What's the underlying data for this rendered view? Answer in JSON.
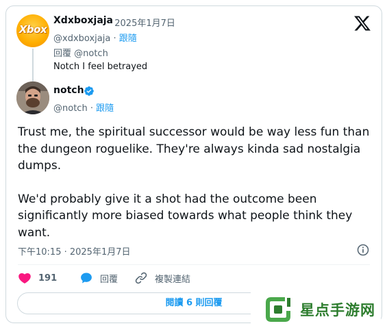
{
  "reply": {
    "display_name": "Xdxboxjaja",
    "date": "· 2025年1月7日",
    "handle": "@xdxboxjaja",
    "follow_label": "跟隨",
    "replying_to": "回覆 @notch",
    "text": "Notch I feel betrayed",
    "avatar_text": "Xbox"
  },
  "tweet": {
    "display_name": "notch",
    "handle": "@notch",
    "follow_label": "跟隨",
    "paragraph1": "Trust me, the spiritual successor would be way less fun than the dungeon roguelike. They're always kinda sad nostalgia dumps.",
    "paragraph2": "We'd probably give it a shot had the outcome been significantly more biased towards what people think they want.",
    "timestamp": "下午10:15 · 2025年1月7日"
  },
  "actions": {
    "like_count": "191",
    "reply_label": "回覆",
    "copy_link_label": "複製連結"
  },
  "read_replies_label": "閱讀 6 則回覆",
  "watermark": {
    "text": "星点手游网"
  },
  "icons": {
    "platform": "x-logo-icon",
    "verified": "verified-badge-icon",
    "info": "info-icon",
    "like": "heart-icon",
    "reply": "speech-bubble-icon",
    "copy_link": "link-icon"
  },
  "colors": {
    "accent": "#1d9bf0",
    "like": "#f91880",
    "secondary_text": "#536471",
    "border": "#cfd9de",
    "watermark_green": "#2d7d2e"
  }
}
